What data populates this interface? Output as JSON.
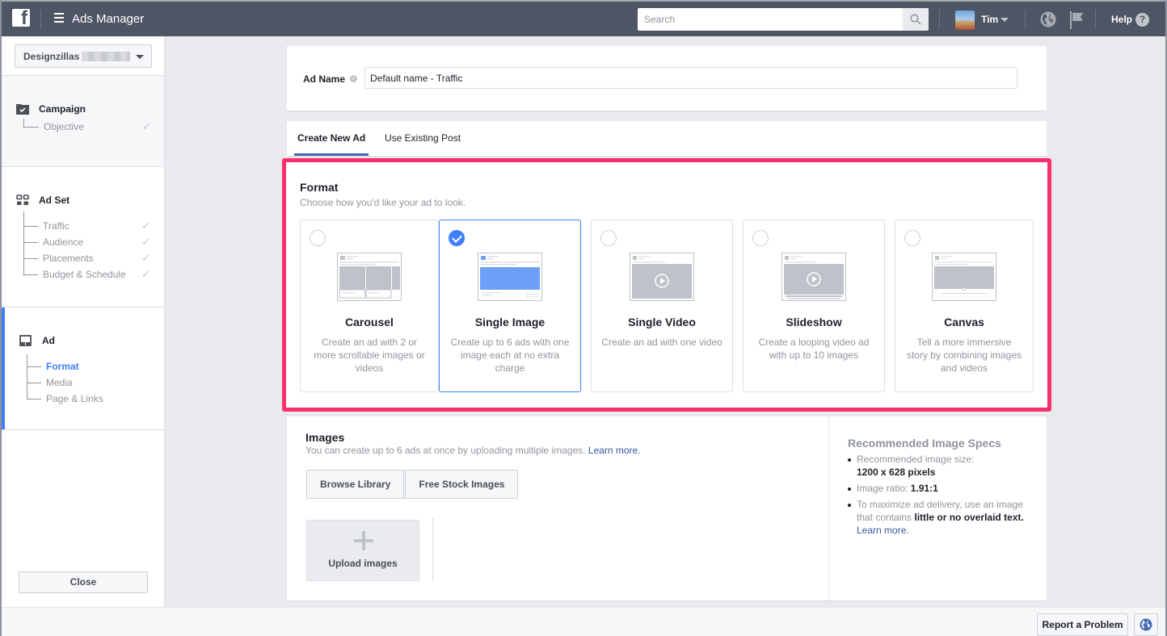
{
  "topbar": {
    "logo": "facebook-logo",
    "menu_icon": "hamburger-icon",
    "app_title": "Ads Manager",
    "search_placeholder": "Search",
    "user_name": "Tim",
    "help_label": "Help",
    "help_glyph": "?"
  },
  "sidebar": {
    "account_name": "Designzillas",
    "campaign": {
      "label": "Campaign",
      "items": [
        {
          "label": "Objective",
          "check": "✓"
        }
      ]
    },
    "adset": {
      "label": "Ad Set",
      "items": [
        {
          "label": "Traffic",
          "check": "✓"
        },
        {
          "label": "Audience",
          "check": "✓"
        },
        {
          "label": "Placements",
          "check": "✓"
        },
        {
          "label": "Budget & Schedule",
          "check": "✓"
        }
      ]
    },
    "ad": {
      "label": "Ad",
      "items": [
        {
          "label": "Format",
          "active": true
        },
        {
          "label": "Media"
        },
        {
          "label": "Page & Links"
        }
      ]
    },
    "close_label": "Close"
  },
  "ad_name": {
    "label": "Ad Name",
    "info_glyph": "i",
    "value": "Default name - Traffic"
  },
  "tabs": [
    {
      "label": "Create New Ad",
      "active": true
    },
    {
      "label": "Use Existing Post",
      "active": false
    }
  ],
  "format": {
    "title": "Format",
    "subtitle": "Choose how you'd like your ad to look.",
    "highlight_color": "#fa2f6d",
    "options": [
      {
        "name": "Carousel",
        "desc": "Create an ad with 2 or more scrollable images or videos",
        "selected": false
      },
      {
        "name": "Single Image",
        "desc": "Create up to 6 ads with one image each at no extra charge",
        "selected": true
      },
      {
        "name": "Single Video",
        "desc": "Create an ad with one video",
        "selected": false
      },
      {
        "name": "Slideshow",
        "desc": "Create a looping video ad with up to 10 images",
        "selected": false
      },
      {
        "name": "Canvas",
        "desc": "Tell a more immersive story by combining images and videos",
        "selected": false
      }
    ]
  },
  "images": {
    "title": "Images",
    "subtitle": "You can create up to 6 ads at once by uploading multiple images.",
    "learn_more": "Learn more.",
    "browse_label": "Browse Library",
    "stock_label": "Free Stock Images",
    "upload_label": "Upload images"
  },
  "specs": {
    "title": "Recommended Image Specs",
    "size_label": "Recommended image size:",
    "size_value": "1200 x 628 pixels",
    "ratio_label": "Image ratio:",
    "ratio_value": "1.91:1",
    "text_tip_pre": "To maximize ad delivery, use an image that contains",
    "text_tip_bold": "little or no overlaid text.",
    "learn_more": "Learn more."
  },
  "footer": {
    "report_label": "Report a Problem"
  },
  "colors": {
    "topbar": "#4e5665",
    "accent": "#4080ff",
    "tab_underline": "#4267b2",
    "link": "#365899"
  }
}
